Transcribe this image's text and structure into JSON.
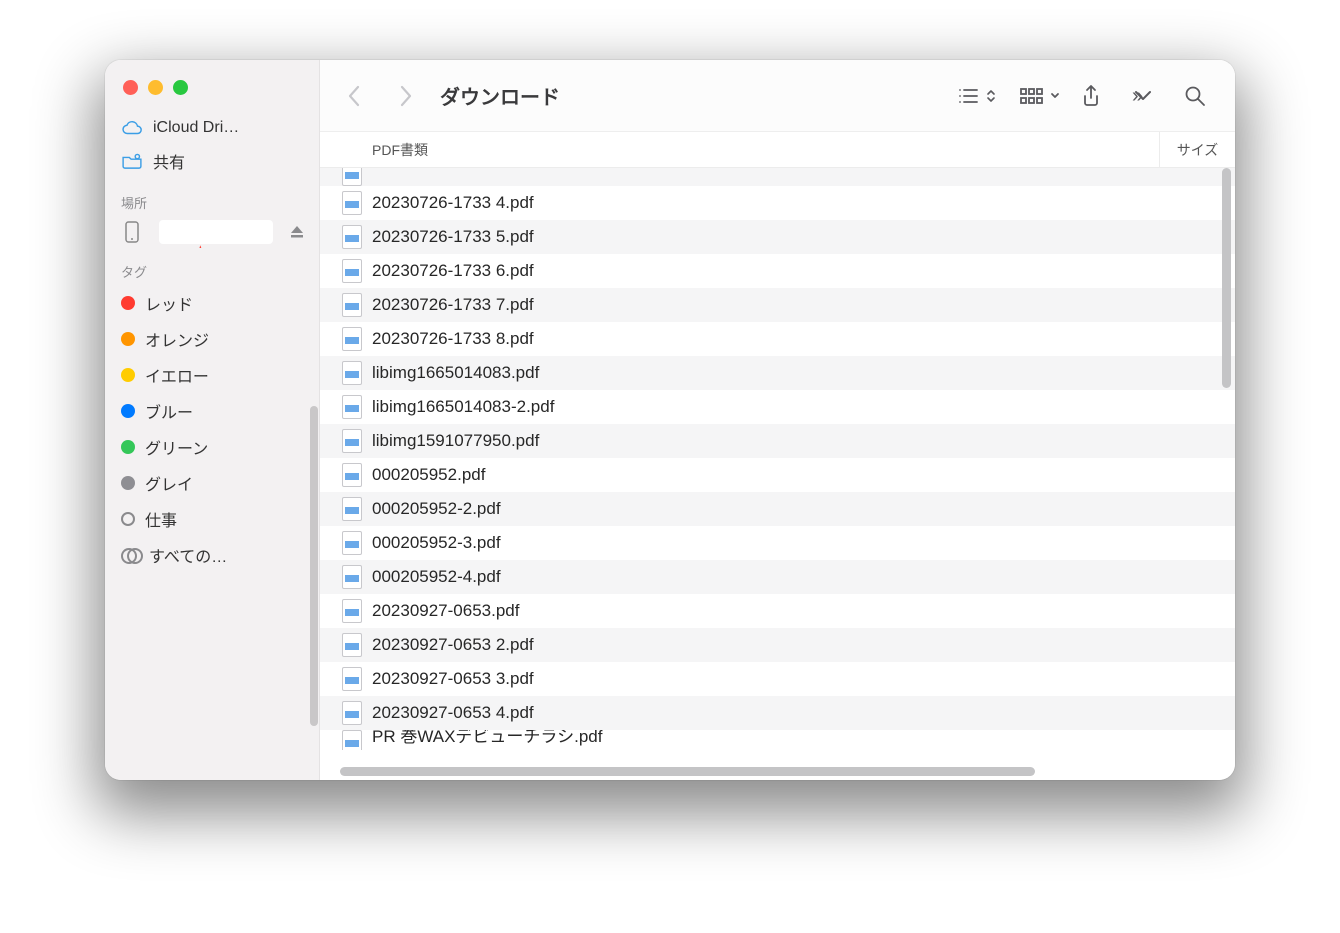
{
  "window": {
    "title": "ダウンロード"
  },
  "sidebar": {
    "icloud_label": "iCloud Dri…",
    "shared_label": "共有",
    "locations_header": "場所",
    "tags_header": "タグ",
    "tags": [
      {
        "label": "レッド",
        "color": "#ff3b30"
      },
      {
        "label": "オレンジ",
        "color": "#ff9500"
      },
      {
        "label": "イエロー",
        "color": "#ffcc00"
      },
      {
        "label": "ブルー",
        "color": "#007aff"
      },
      {
        "label": "グリーン",
        "color": "#34c759"
      },
      {
        "label": "グレイ",
        "color": "#8e8e93"
      }
    ],
    "work_tag_label": "仕事",
    "all_tags_label": "すべての…"
  },
  "columns": {
    "name_header": "PDF書類",
    "size_header": "サイズ"
  },
  "files": [
    "20230726-1733 4.pdf",
    "20230726-1733 5.pdf",
    "20230726-1733 6.pdf",
    "20230726-1733 7.pdf",
    "20230726-1733 8.pdf",
    "libimg1665014083.pdf",
    "libimg1665014083-2.pdf",
    "libimg1591077950.pdf",
    "000205952.pdf",
    "000205952-2.pdf",
    "000205952-3.pdf",
    "000205952-4.pdf",
    "20230927-0653.pdf",
    "20230927-0653 2.pdf",
    "20230927-0653 3.pdf",
    "20230927-0653 4.pdf"
  ],
  "files_cut_bottom": "PR 巻WAXデビューチラシ.pdf"
}
